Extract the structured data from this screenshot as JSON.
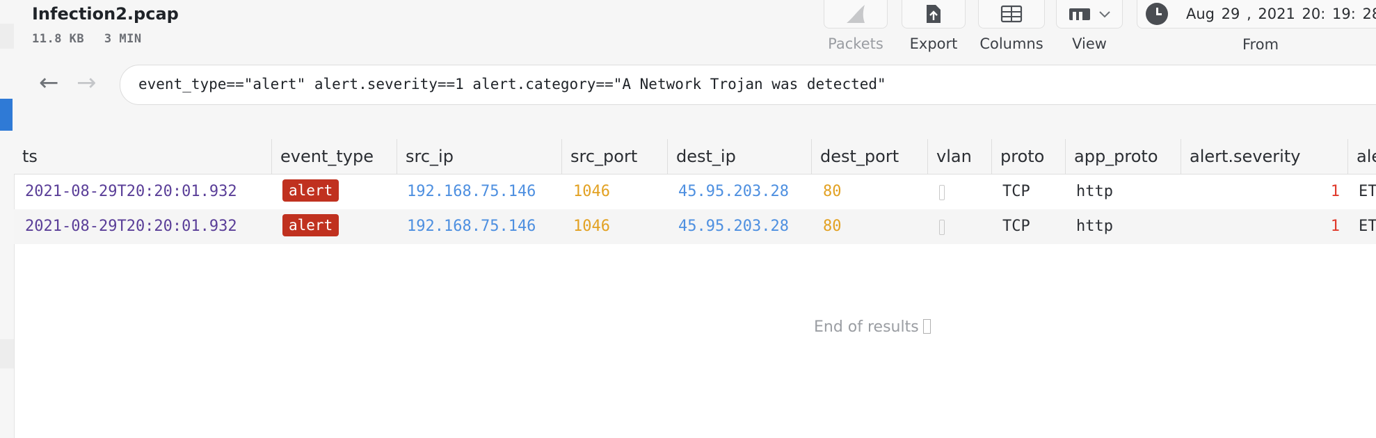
{
  "file": {
    "title": "Infection2.pcap",
    "size": "11.8 KB",
    "duration": "3 MIN"
  },
  "toolbar": {
    "packets_label": "Packets",
    "export_label": "Export",
    "columns_label": "Columns",
    "view_label": "View",
    "from_label": "From",
    "from_value": "Aug 29 , 2021 20: 19: 28"
  },
  "search": {
    "query": "event_type==\"alert\" alert.severity==1 alert.category==\"A Network Trojan was detected\""
  },
  "table": {
    "columns": [
      "ts",
      "event_type",
      "src_ip",
      "src_port",
      "dest_ip",
      "dest_port",
      "vlan",
      "proto",
      "app_proto",
      "alert.severity",
      "ale"
    ],
    "rows": [
      {
        "ts": "2021-08-29T20:20:01.932",
        "event_type": "alert",
        "src_ip": "192.168.75.146",
        "src_port": "1046",
        "dest_ip": "45.95.203.28",
        "dest_port": "80",
        "proto": "TCP",
        "app_proto": "http",
        "severity": "1",
        "alert": "ET"
      },
      {
        "ts": "2021-08-29T20:20:01.932",
        "event_type": "alert",
        "src_ip": "192.168.75.146",
        "src_port": "1046",
        "dest_ip": "45.95.203.28",
        "dest_port": "80",
        "proto": "TCP",
        "app_proto": "http",
        "severity": "1",
        "alert": "ET"
      }
    ],
    "end_text": "End of results"
  },
  "colors": {
    "ts": "#5a3e98",
    "ip": "#4d8fe0",
    "port": "#e2a122",
    "alert_badge": "#c0311f",
    "severity": "#e0392b",
    "active_accent": "#2f7ad6"
  },
  "icons": {
    "packets": "shark-fin-icon",
    "export": "export-file-icon",
    "columns": "columns-icon",
    "view": "view-layout-icon",
    "from": "clock-icon",
    "back": "arrow-left-icon",
    "forward": "arrow-right-icon"
  }
}
